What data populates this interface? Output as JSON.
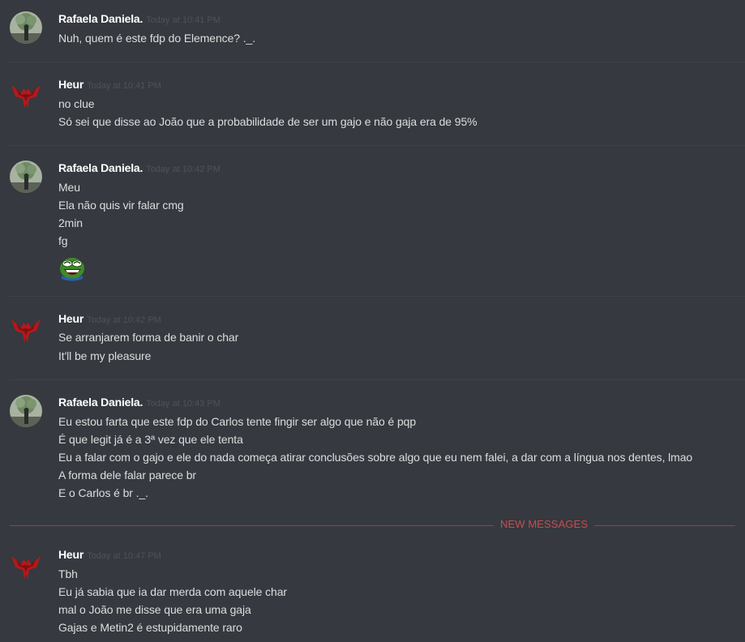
{
  "colors": {
    "background": "#36393f",
    "username": "#ffffff",
    "timestamp": "#4f5257",
    "text": "#dcddde",
    "new_messages": "#c15050"
  },
  "messages": [
    {
      "author": "Rafaela Daniela.",
      "avatar": "rafaela-avatar",
      "time": "Today at 10:41 PM",
      "lines": [
        "Nuh, quem é este fdp do Elemence? ._."
      ]
    },
    {
      "author": "Heur",
      "avatar": "heur-red-logo-avatar",
      "time": "Today at 10:41 PM",
      "lines": [
        "no clue",
        "Só sei que disse ao João que a probabilidade de ser um gajo e não gaja era de 95%"
      ]
    },
    {
      "author": "Rafaela Daniela.",
      "avatar": "rafaela-avatar",
      "time": "Today at 10:42 PM",
      "lines": [
        "Meu",
        "Ela não quis vir falar cmg",
        "2min",
        "fg"
      ],
      "emoji": "laughing-pepe-emoji"
    },
    {
      "author": "Heur",
      "avatar": "heur-red-logo-avatar",
      "time": "Today at 10:42 PM",
      "lines": [
        "Se arranjarem forma de banir o char",
        "It'll be my pleasure"
      ]
    },
    {
      "author": "Rafaela Daniela.",
      "avatar": "rafaela-avatar",
      "time": "Today at 10:43 PM",
      "lines": [
        "Eu estou farta que este fdp do Carlos tente fingir ser algo que não é pqp",
        "É que legit já é a 3ª vez que ele tenta",
        "Eu a falar com o gajo e ele do nada começa atirar conclusões sobre algo que eu nem falei, a dar com a língua nos dentes, lmao",
        "A forma dele falar parece br",
        "E o Carlos é br ._."
      ]
    },
    {
      "author": "Heur",
      "avatar": "heur-red-logo-avatar",
      "time": "Today at 10:47 PM",
      "lines": [
        "Tbh",
        "Eu já sabia que ia dar merda com aquele char",
        "mal o João me disse que era uma gaja",
        "Gajas e Metin2 é estupidamente raro"
      ]
    }
  ],
  "new_messages_label": "NEW MESSAGES"
}
